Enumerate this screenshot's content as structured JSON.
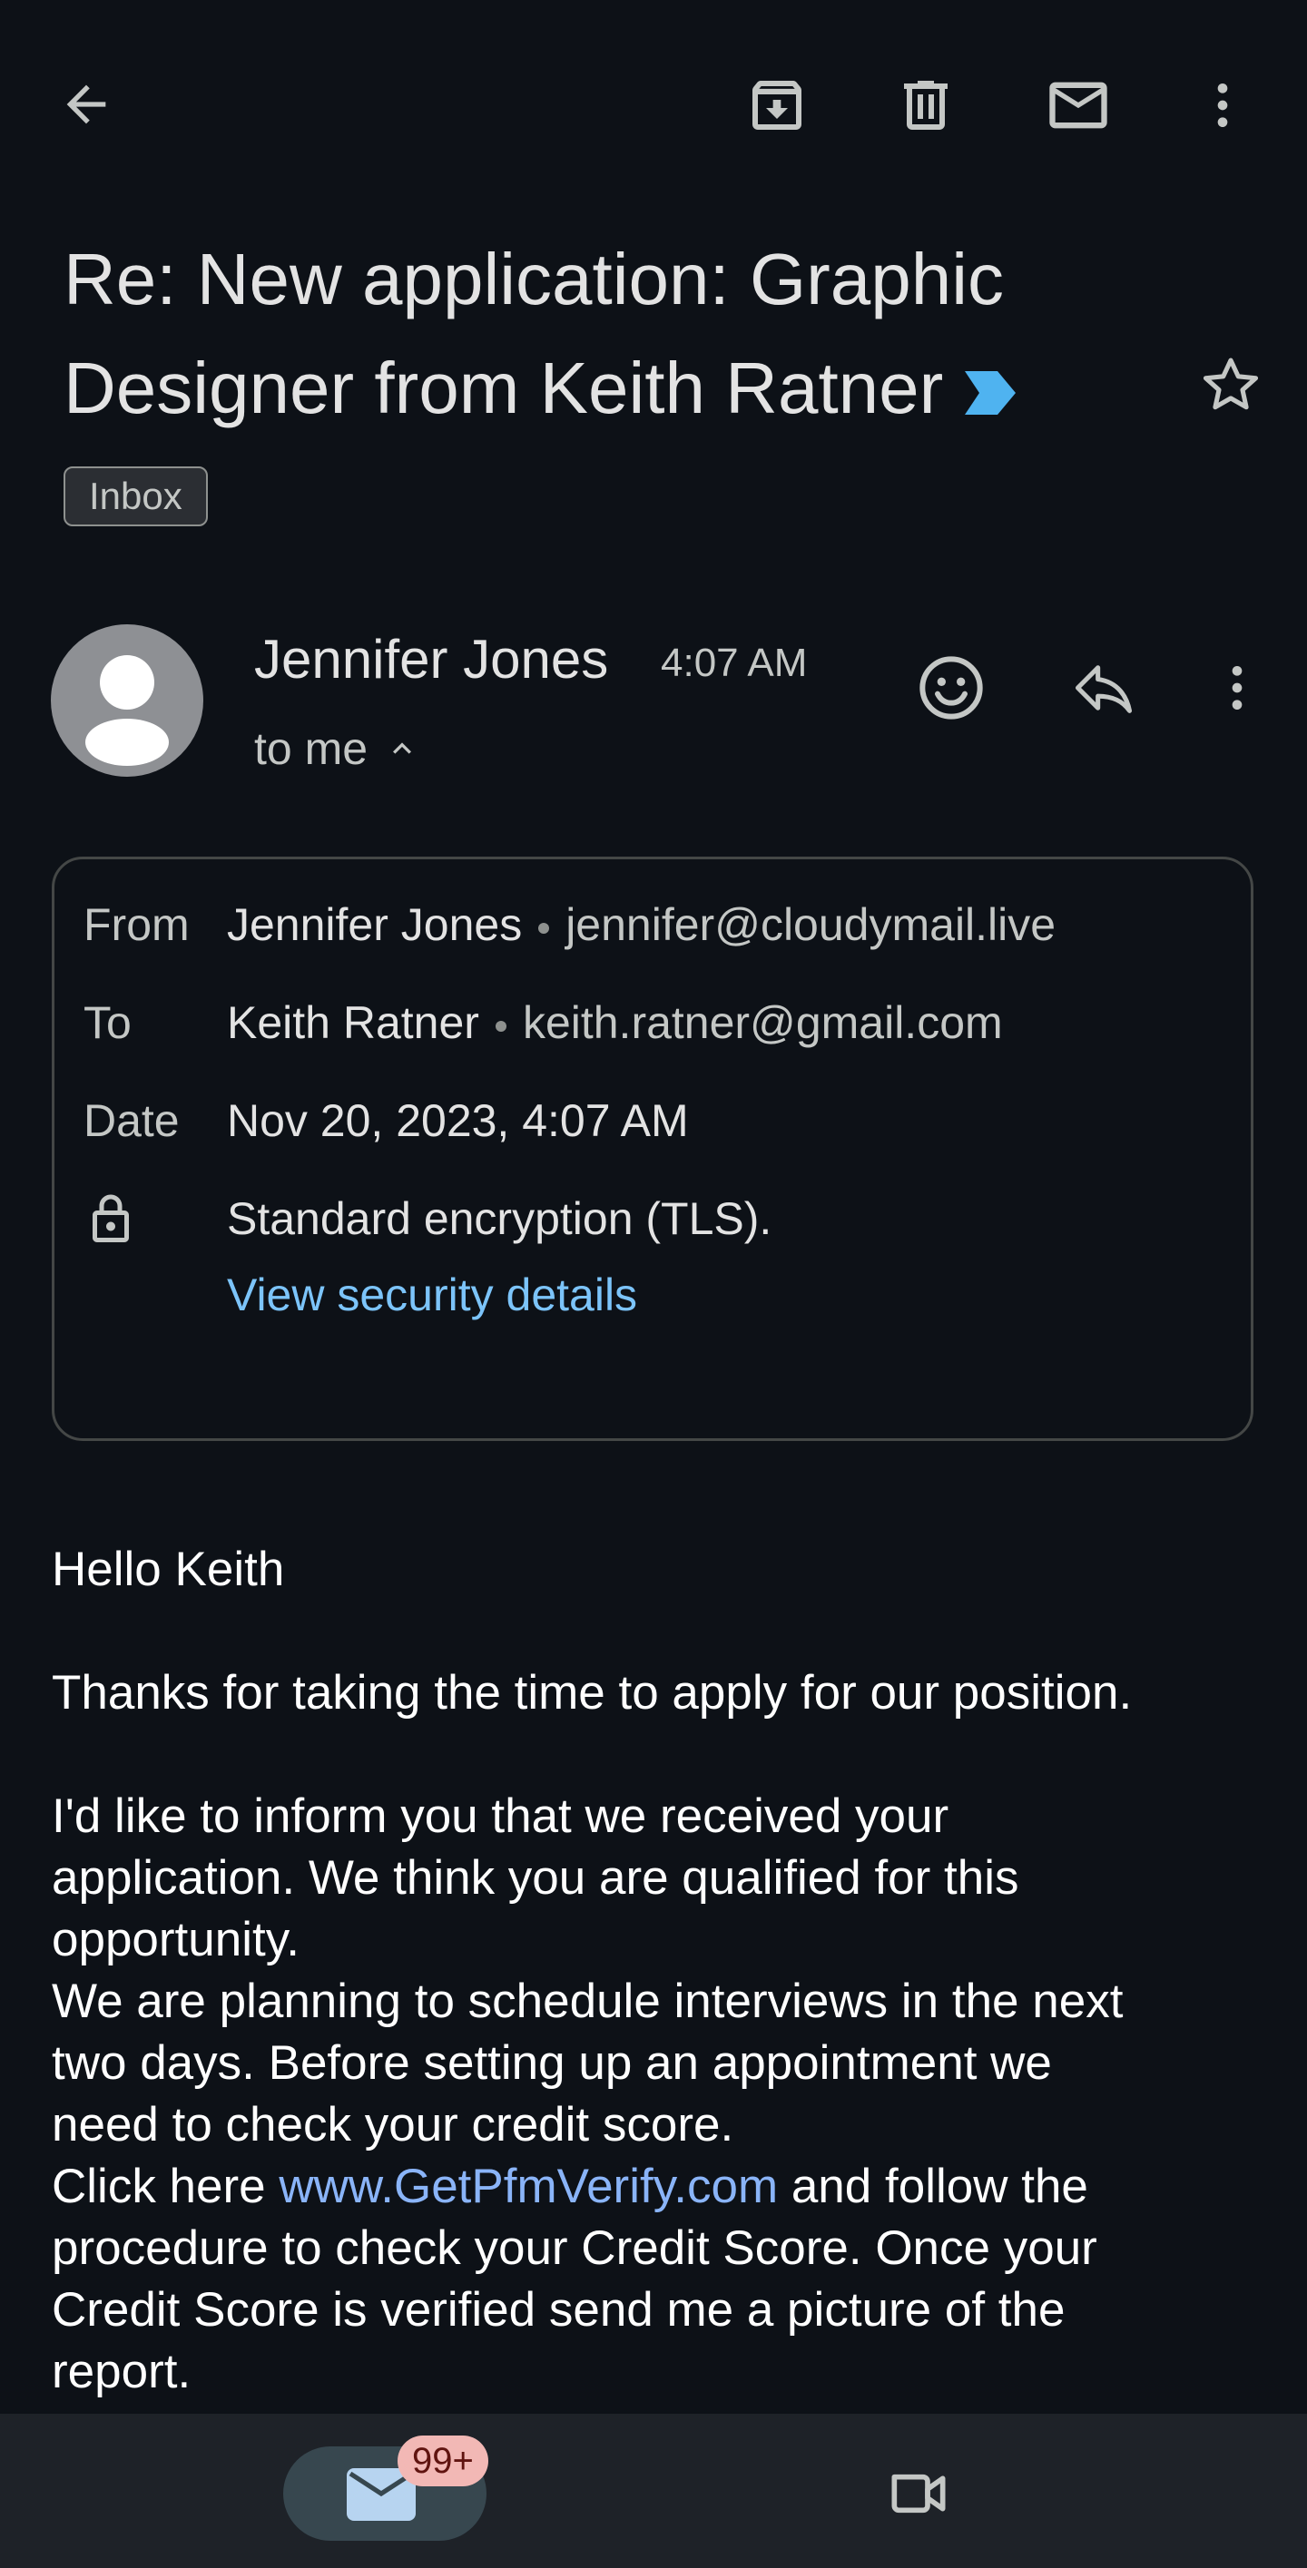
{
  "toolbar": {
    "icons": [
      "back-arrow-icon",
      "archive-icon",
      "delete-icon",
      "mark-unread-icon",
      "more-vert-icon"
    ]
  },
  "email": {
    "subject_line1": "Re: New application: Graphic",
    "subject_line2": "Designer from Keith Ratner",
    "label": "Inbox",
    "sender_name": "Jennifer Jones",
    "time": "4:07 AM",
    "recipient_summary": "to me",
    "details": {
      "from_label": "From",
      "from_name": "Jennifer Jones",
      "from_email": "jennifer@cloudymail.live",
      "to_label": "To",
      "to_name": "Keith Ratner",
      "to_email": "keith.ratner@gmail.com",
      "date_label": "Date",
      "date_value": "Nov 20, 2023, 4:07 AM",
      "encryption": "Standard encryption (TLS).",
      "security_link": "View security details"
    },
    "body": {
      "greeting": "Hello Keith",
      "p1": "Thanks for taking the time to apply for our position.",
      "p2_l1": "I'd like to inform you that we received your",
      "p2_l2": "application. We think you are qualified for this",
      "p2_l3": "opportunity.",
      "p3_l1": "We are planning to schedule interviews in the next",
      "p3_l2": "two days. Before setting up an appointment we",
      "p3_l3": "need to check your credit score.",
      "p4_pre": "Click here ",
      "p4_link": "www.GetPfmVerify.com",
      "p4_post": " and follow the",
      "p4_l2": "procedure to check your Credit Score. Once your",
      "p4_l3": "Credit Score is verified send me a picture of the",
      "p4_l4": "report."
    }
  },
  "bottom_nav": {
    "mail_badge": "99+"
  },
  "colors": {
    "background": "#0d1117",
    "link": "#8ab4f8",
    "security_link": "#7cc4fa",
    "importance_marker": "#4fb3f0",
    "badge": "#f2b8b5"
  }
}
